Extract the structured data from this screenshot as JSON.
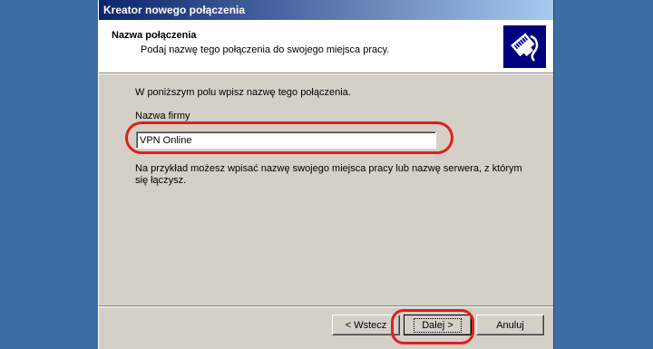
{
  "window": {
    "title": "Kreator nowego połączenia"
  },
  "header": {
    "title": "Nazwa połączenia",
    "subtitle": "Podaj nazwę tego połączenia do swojego miejsca pracy.",
    "icon": "network-cable-icon"
  },
  "body": {
    "instruction": "W poniższym polu wpisz nazwę tego połączenia.",
    "field_label": "Nazwa firmy",
    "field_value": "VPN Online",
    "hint": "Na przykład możesz wpisać nazwę swojego miejsca pracy lub nazwę serwera, z którym się łączysz."
  },
  "buttons": {
    "back": "< Wstecz",
    "next": "Dalej >",
    "cancel": "Anuluj"
  },
  "annotations": {
    "highlight_color": "#e0201a"
  },
  "colors": {
    "desktop": "#3a6ea5",
    "dialog": "#d4d0c8",
    "title_start": "#0a246a",
    "title_end": "#a6caf0",
    "icon_bg": "#00007e"
  }
}
